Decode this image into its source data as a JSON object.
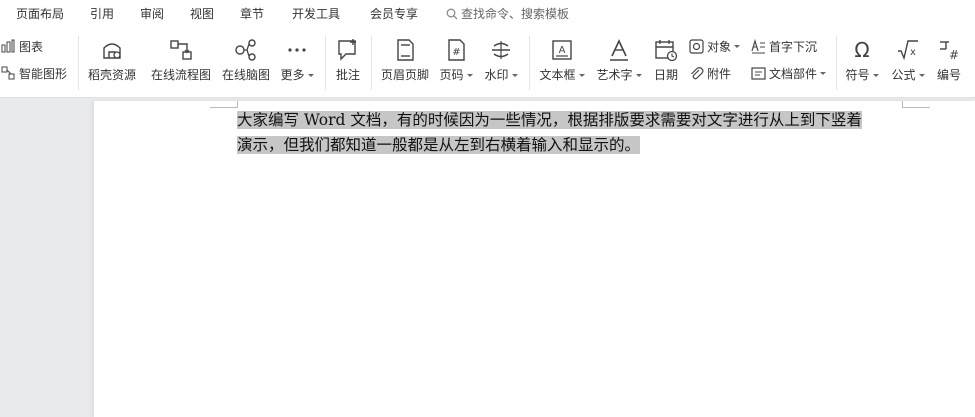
{
  "menu": {
    "items": [
      "页面布局",
      "引用",
      "审阅",
      "视图",
      "章节",
      "开发工具",
      "会员专享"
    ],
    "search_placeholder": "查找命令、搜索模板"
  },
  "toolbar": {
    "chart": "图表",
    "smart_shape": "智能图形",
    "docer_resources": "稻壳资源",
    "online_flowchart": "在线流程图",
    "online_mindmap": "在线脑图",
    "more": "更多",
    "comment": "批注",
    "header_footer": "页眉页脚",
    "page_number": "页码",
    "watermark": "水印",
    "text_box": "文本框",
    "word_art": "艺术字",
    "date": "日期",
    "object": "对象",
    "attachment": "附件",
    "drop_cap": "首字下沉",
    "doc_parts": "文档部件",
    "symbol": "符号",
    "formula": "公式",
    "numbering": "编号"
  },
  "document": {
    "paragraph": "大家编写 Word 文档，有的时候因为一些情况，根据排版要求需要对文字进行从上到下竖着演示，但我们都知道一般都是从左到右横着输入和显示的。",
    "line1": "大家编写 Word 文档，有的时候因为一些情况，根据排版要求需要对文字进行从上到下竖着",
    "line2": "演示，但我们都知道一般都是从左到右横着输入和显示的。"
  }
}
